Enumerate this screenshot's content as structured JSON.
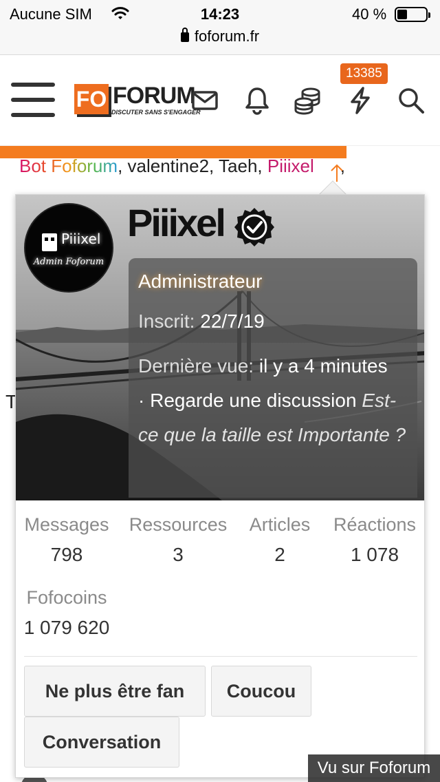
{
  "status_bar": {
    "carrier": "Aucune SIM",
    "time": "14:23",
    "battery_percent": "40 %",
    "url": "foforum.fr"
  },
  "header": {
    "logo_fo": "FO",
    "logo_forum": "FORUM",
    "logo_tagline": "DISCUTER SANS S'ENGAGER",
    "notification_count": "13385",
    "read_progress": 0.79
  },
  "background": {
    "online_bot": "Bot Foforum",
    "online_users": ", valentine2, Taeh, ",
    "online_user_admin": "Piiixel",
    "trailing_comma": ",",
    "partial_letter": "T"
  },
  "profile": {
    "avatar_name": "Piiixel",
    "avatar_subtitle": "Admin Foforum",
    "username": "Piiixel",
    "role": "Administrateur",
    "joined_label": "Inscrit:",
    "joined_value": "22/7/19",
    "last_seen_label": "Dernière vue:",
    "last_seen_value": "il y a 4 minutes",
    "activity": "· Regarde une discussion",
    "activity_thread": "Est-ce que la taille est Importante ?",
    "stats": [
      {
        "label": "Messages",
        "value": "798"
      },
      {
        "label": "Ressources",
        "value": "3"
      },
      {
        "label": "Articles",
        "value": "2"
      },
      {
        "label": "Réactions",
        "value": "1 078"
      },
      {
        "label": "Fofocoins",
        "value": "1 079 620"
      }
    ],
    "buttons": {
      "unfan": "Ne plus être fan",
      "hello": "Coucou",
      "conversation": "Conversation"
    }
  },
  "watermark": "Vu sur Foforum",
  "colors": {
    "accent": "#f47c1f",
    "badge": "#e8661c",
    "admin_name": "#c41b6b"
  }
}
